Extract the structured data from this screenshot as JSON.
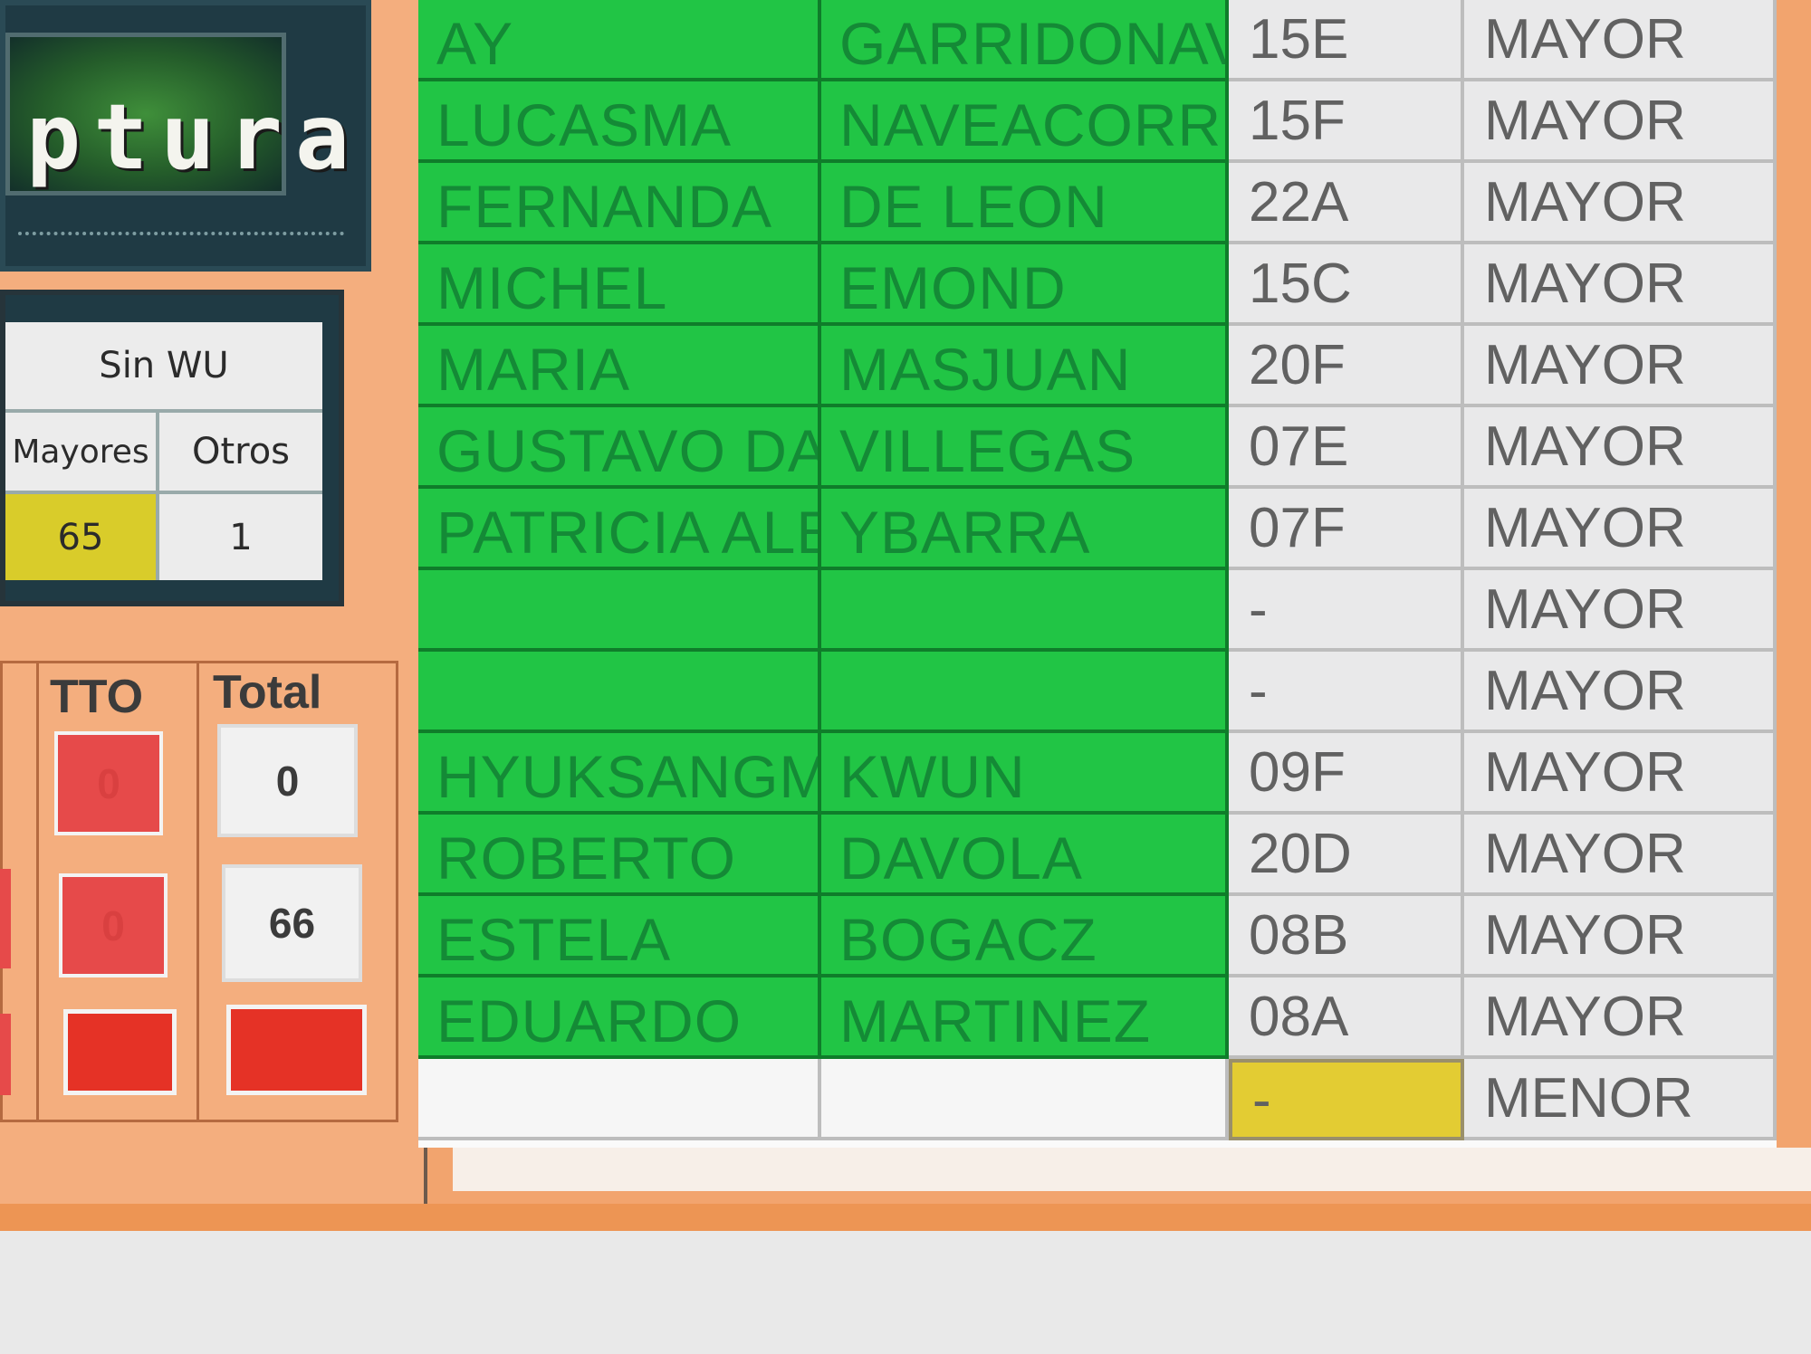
{
  "logo": {
    "text": "ptura"
  },
  "counts": {
    "header": "Sin WU",
    "col1_label": "Mayores",
    "col2_label": "Otros",
    "col1_value": "65",
    "col2_value": "1"
  },
  "totals": {
    "tto_label": "TTO",
    "total_label": "Total",
    "tto_values": [
      "0",
      "0",
      ""
    ],
    "total_values": [
      "0",
      "66",
      ""
    ]
  },
  "passengers": [
    {
      "first": "AY",
      "last": "GARRIDONAV",
      "seat": "15E",
      "category": "MAYOR"
    },
    {
      "first": "LUCASMA",
      "last": "NAVEACORRE",
      "seat": "15F",
      "category": "MAYOR"
    },
    {
      "first": "FERNANDA",
      "last": "DE LEON",
      "seat": "22A",
      "category": "MAYOR"
    },
    {
      "first": "MICHEL",
      "last": "EMOND",
      "seat": "15C",
      "category": "MAYOR"
    },
    {
      "first": "MARIA",
      "last": "MASJUAN",
      "seat": "20F",
      "category": "MAYOR"
    },
    {
      "first": "GUSTAVO DA",
      "last": "VILLEGAS",
      "seat": "07E",
      "category": "MAYOR"
    },
    {
      "first": "PATRICIA ALE",
      "last": "YBARRA",
      "seat": "07F",
      "category": "MAYOR"
    },
    {
      "first": "",
      "last": "",
      "seat": "-",
      "category": "MAYOR"
    },
    {
      "first": "",
      "last": "",
      "seat": "-",
      "category": "MAYOR"
    },
    {
      "first": "HYUKSANGMI",
      "last": "KWUN",
      "seat": "09F",
      "category": "MAYOR"
    },
    {
      "first": "ROBERTO",
      "last": "DAVOLA",
      "seat": "20D",
      "category": "MAYOR"
    },
    {
      "first": "ESTELA",
      "last": "BOGACZ",
      "seat": "08B",
      "category": "MAYOR"
    },
    {
      "first": "EDUARDO",
      "last": "MARTINEZ",
      "seat": "08A",
      "category": "MAYOR"
    },
    {
      "first": "",
      "last": "",
      "seat": "-",
      "category": "MENOR"
    }
  ],
  "colors": {
    "green_cell": "#21c545",
    "green_text": "#148a36",
    "yellow": "#e3cc33",
    "red": "#e64a4a",
    "orange_bg": "#f2a46e"
  }
}
